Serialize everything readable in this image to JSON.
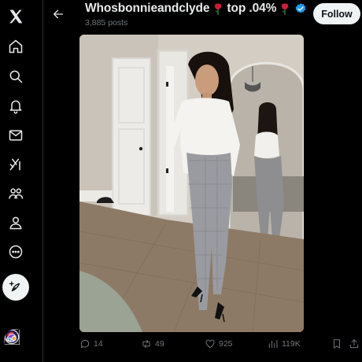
{
  "header": {
    "title_name": "Whosbonnieandclyde",
    "title_middle": "top .04%",
    "post_count": "3,885 posts",
    "follow_label": "Follow"
  },
  "nav": [
    "x-logo-icon",
    "home-icon",
    "explore-icon",
    "notifications-icon",
    "messages-icon",
    "grok-icon",
    "communities-icon",
    "profile-icon",
    "more-icon"
  ],
  "actions": {
    "replies": "14",
    "reposts": "49",
    "likes": "925",
    "views": "119K"
  },
  "colors": {
    "background": "#000000",
    "text": "#e7e9ea",
    "muted": "#71767b",
    "verified": "#1d9bf0",
    "follow_bg": "#eff3f4"
  }
}
